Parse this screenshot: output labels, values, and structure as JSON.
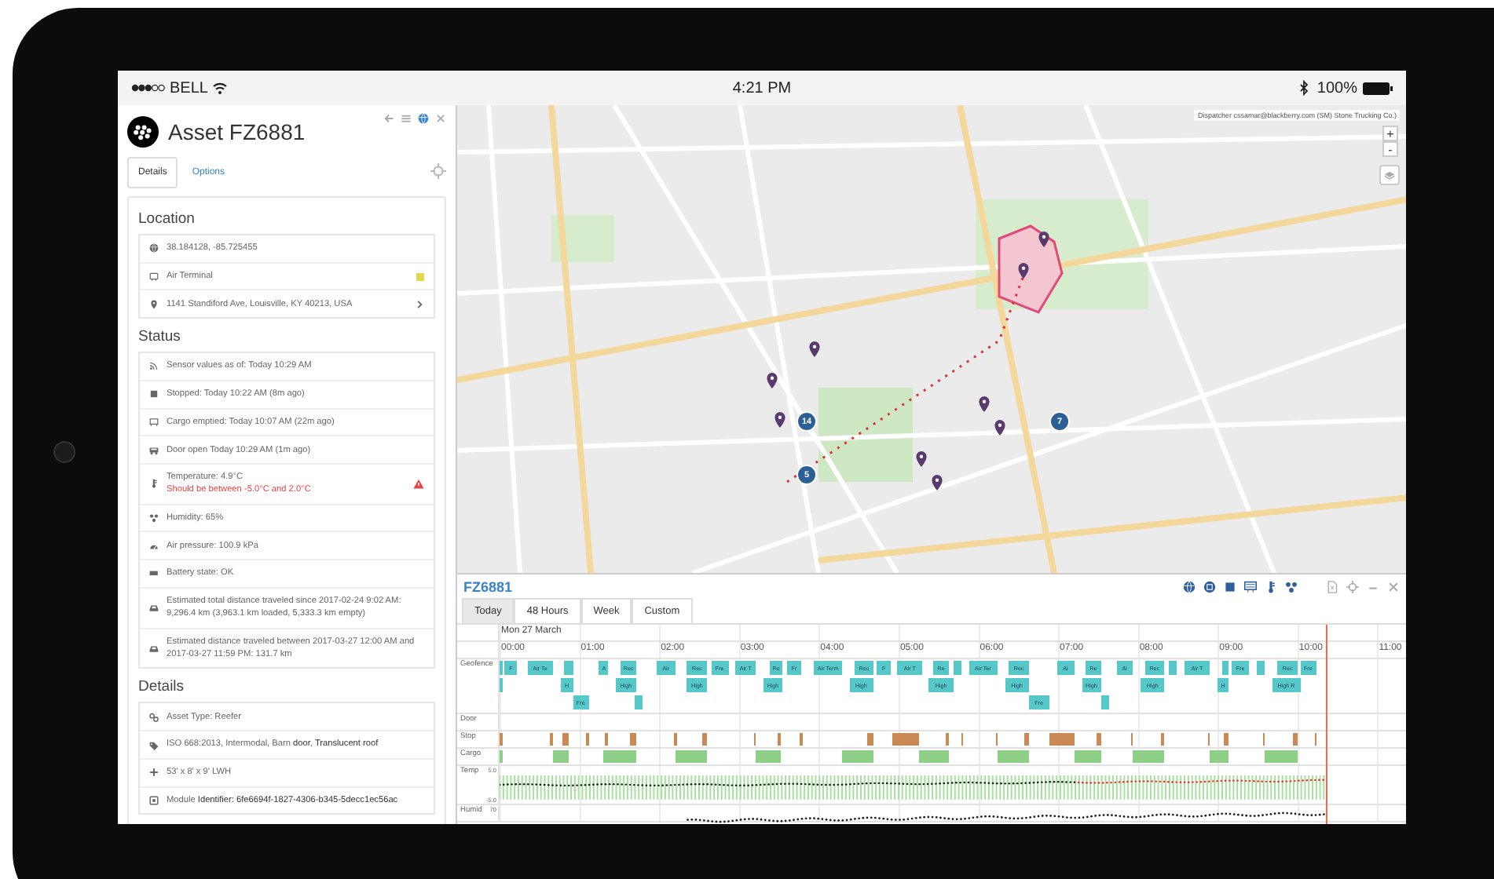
{
  "status_bar": {
    "carrier": "BELL",
    "time": "4:21 PM",
    "battery": "100%"
  },
  "asset_panel": {
    "title": "Asset FZ6881",
    "tabs": [
      {
        "label": "Details",
        "selected": true
      },
      {
        "label": "Options",
        "selected": false
      }
    ],
    "sections": [
      {
        "title": "Location",
        "rows": [
          {
            "kind": "plain",
            "text": "38.184128, -85.725455"
          },
          {
            "kind": "tagged",
            "text": "Air Terminal",
            "color": "#e3d94c"
          },
          {
            "kind": "link",
            "text": "1141 Standiford Ave, Louisville, KY 40213, USA"
          }
        ]
      },
      {
        "title": "Status",
        "rows": [
          {
            "kind": "plain",
            "text": "Sensor values as of: Today 10:29 AM"
          },
          {
            "kind": "plain",
            "text": "Stopped: Today 10:22 AM (8m ago)"
          },
          {
            "kind": "plain",
            "text": "Cargo emptied: Today 10:07 AM (22m ago)"
          },
          {
            "kind": "plain",
            "text": "Door open Today 10:29 AM (1m ago)"
          },
          {
            "kind": "alert",
            "text": "Temperature: 4.9°C",
            "note": "Should be between -5.0°C and 2.0°C"
          },
          {
            "kind": "plain",
            "text": "Humidity: 65%"
          },
          {
            "kind": "plain",
            "text": "Air pressure: 100.9 kPa"
          },
          {
            "kind": "plain",
            "text": "Battery state: OK"
          },
          {
            "kind": "plain",
            "text": "Estimated total distance traveled since 2017-02-24 9:02 AM: 9,296.4 km (3,963.1 km loaded, 5,333.3 km empty)"
          },
          {
            "kind": "plain",
            "text": "Estimated distance traveled between 2017-03-27 12:00 AM and 2017-03-27 11:59 PM: 131.7 km"
          }
        ]
      },
      {
        "title": "Details",
        "rows": [
          {
            "kind": "plain",
            "text": "Asset Type: Reefer"
          },
          {
            "kind": "plain",
            "text": "ISO 668:2013, Intermodal, Barn **door**, **Translucent roof**"
          },
          {
            "kind": "plain",
            "text": "53' x 8' x 9' LWH"
          },
          {
            "kind": "plain",
            "text": "Module **Identifier: 6fe6694f-1827-4306-b345-5decc1ec56ac**"
          }
        ]
      }
    ]
  },
  "map": {
    "attribution": "Dispatcher cssamar@blackberry.com (SM) Stone Trucking Co.)",
    "zoom_in": "+",
    "zoom_out": "-",
    "clusters": [
      {
        "count": "14"
      },
      {
        "count": "5"
      },
      {
        "count": "7"
      }
    ]
  },
  "timeline": {
    "title": "FZ6881",
    "tabs": [
      {
        "label": "Today",
        "selected": true
      },
      {
        "label": "48 Hours",
        "selected": false
      },
      {
        "label": "Week",
        "selected": false
      },
      {
        "label": "Custom",
        "selected": false
      }
    ],
    "date": "Mon 27 March",
    "hours": [
      "00:00",
      "01:00",
      "02:00",
      "03:00",
      "04:00",
      "05:00",
      "06:00",
      "07:00",
      "08:00",
      "09:00",
      "10:00",
      "11:00"
    ],
    "rows": [
      {
        "kind": "geofence",
        "label": "Geofence",
        "lanes": [
          [
            "F",
            "Air Te",
            "A",
            "Rec",
            "Air",
            "Rec",
            "Fre",
            "Air T",
            "Re",
            "Fr",
            "Air Term",
            "Rec",
            "F",
            "Air T",
            "Re",
            "Air Ter",
            "Rec",
            "Ai",
            "Re",
            "Ai",
            "Rec",
            "Air T",
            "Fre",
            "Rec",
            "Fre"
          ],
          [
            "H",
            "High",
            "High",
            "High",
            "High",
            "High",
            "High",
            "High",
            "High",
            "H",
            "High R"
          ],
          [
            "Fre",
            "Fre"
          ]
        ]
      },
      {
        "kind": "events",
        "label": "Door"
      },
      {
        "kind": "events",
        "label": "Stop",
        "color": "#c98a55"
      },
      {
        "kind": "events",
        "label": "Cargo",
        "color": "#8dcf86"
      },
      {
        "kind": "temperature",
        "label": "Temp",
        "ticks": [
          "5.0",
          "-5.0"
        ]
      },
      {
        "kind": "humidity",
        "label": "Humid",
        "ticks": [
          "70"
        ]
      }
    ]
  }
}
